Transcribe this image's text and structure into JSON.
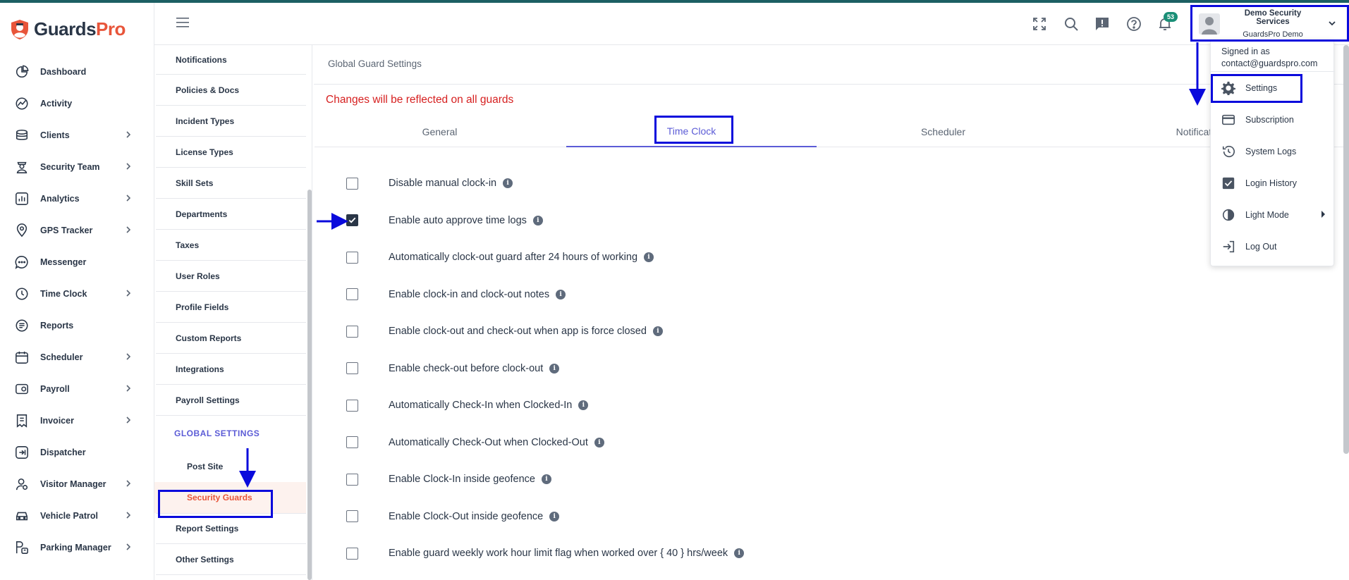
{
  "brand": {
    "name_part1": "Guards",
    "name_part2": "Pro",
    "accent": "#e8553a",
    "primary": "#5b5bd6"
  },
  "sidebar": {
    "items": [
      {
        "label": "Dashboard",
        "icon": "dashboard-icon",
        "has_submenu": false
      },
      {
        "label": "Activity",
        "icon": "activity-icon",
        "has_submenu": false
      },
      {
        "label": "Clients",
        "icon": "clients-icon",
        "has_submenu": true
      },
      {
        "label": "Security Team",
        "icon": "security-team-icon",
        "has_submenu": true
      },
      {
        "label": "Analytics",
        "icon": "analytics-icon",
        "has_submenu": true
      },
      {
        "label": "GPS Tracker",
        "icon": "location-pin-icon",
        "has_submenu": true
      },
      {
        "label": "Messenger",
        "icon": "chat-icon",
        "has_submenu": false
      },
      {
        "label": "Time Clock",
        "icon": "clock-icon",
        "has_submenu": true
      },
      {
        "label": "Reports",
        "icon": "reports-icon",
        "has_submenu": false
      },
      {
        "label": "Scheduler",
        "icon": "calendar-icon",
        "has_submenu": true
      },
      {
        "label": "Payroll",
        "icon": "payroll-icon",
        "has_submenu": true
      },
      {
        "label": "Invoicer",
        "icon": "invoice-icon",
        "has_submenu": true
      },
      {
        "label": "Dispatcher",
        "icon": "dispatch-icon",
        "has_submenu": false
      },
      {
        "label": "Visitor Manager",
        "icon": "visitor-icon",
        "has_submenu": true
      },
      {
        "label": "Vehicle Patrol",
        "icon": "car-icon",
        "has_submenu": true
      },
      {
        "label": "Parking Manager",
        "icon": "parking-icon",
        "has_submenu": true
      }
    ]
  },
  "settings_menu": {
    "items": [
      "Notifications",
      "Policies & Docs",
      "Incident Types",
      "License Types",
      "Skill Sets",
      "Departments",
      "Taxes",
      "User Roles",
      "Profile Fields",
      "Custom Reports",
      "Integrations",
      "Payroll Settings"
    ],
    "section_heading": "GLOBAL SETTINGS",
    "section_children": [
      "Post Site",
      "Security Guards"
    ],
    "active_child": "Security Guards",
    "after_items": [
      "Report Settings",
      "Other Settings"
    ]
  },
  "header": {
    "notification_count": "53",
    "user_company": "Demo Security Services",
    "user_name": "GuardsPro Demo"
  },
  "main": {
    "title": "Global Guard Settings",
    "warning": "Changes will be reflected on all guards",
    "warning_color": "#d61f1f",
    "tabs": [
      "General",
      "Time Clock",
      "Scheduler",
      "Notificati"
    ],
    "active_tab": "Time Clock",
    "options": [
      {
        "label": "Disable manual clock-in",
        "checked": false
      },
      {
        "label": "Enable auto approve time logs",
        "checked": true
      },
      {
        "label": "Automatically clock-out guard after 24 hours of working",
        "checked": false
      },
      {
        "label": "Enable clock-in and clock-out notes",
        "checked": false
      },
      {
        "label": "Enable clock-out and check-out when app is force closed",
        "checked": false
      },
      {
        "label": "Enable check-out before clock-out",
        "checked": false
      },
      {
        "label": "Automatically Check-In when Clocked-In",
        "checked": false
      },
      {
        "label": "Automatically Check-Out when Clocked-Out",
        "checked": false
      },
      {
        "label": "Enable Clock-In inside geofence",
        "checked": false
      },
      {
        "label": "Enable Clock-Out inside geofence",
        "checked": false
      },
      {
        "label": "Enable guard weekly work hour limit flag when worked over { 40 } hrs/week",
        "checked": false
      }
    ]
  },
  "user_dropdown": {
    "signed_in_label": "Signed in as",
    "email": "contact@guardspro.com",
    "items": [
      {
        "label": "Settings",
        "icon": "gear-icon"
      },
      {
        "label": "Subscription",
        "icon": "credit-card-icon"
      },
      {
        "label": "System Logs",
        "icon": "history-icon"
      },
      {
        "label": "Login History",
        "icon": "checkbox-icon"
      },
      {
        "label": "Light Mode",
        "icon": "contrast-icon"
      },
      {
        "label": "Log Out",
        "icon": "logout-icon"
      }
    ]
  },
  "annotation_color": "#0a0adc"
}
